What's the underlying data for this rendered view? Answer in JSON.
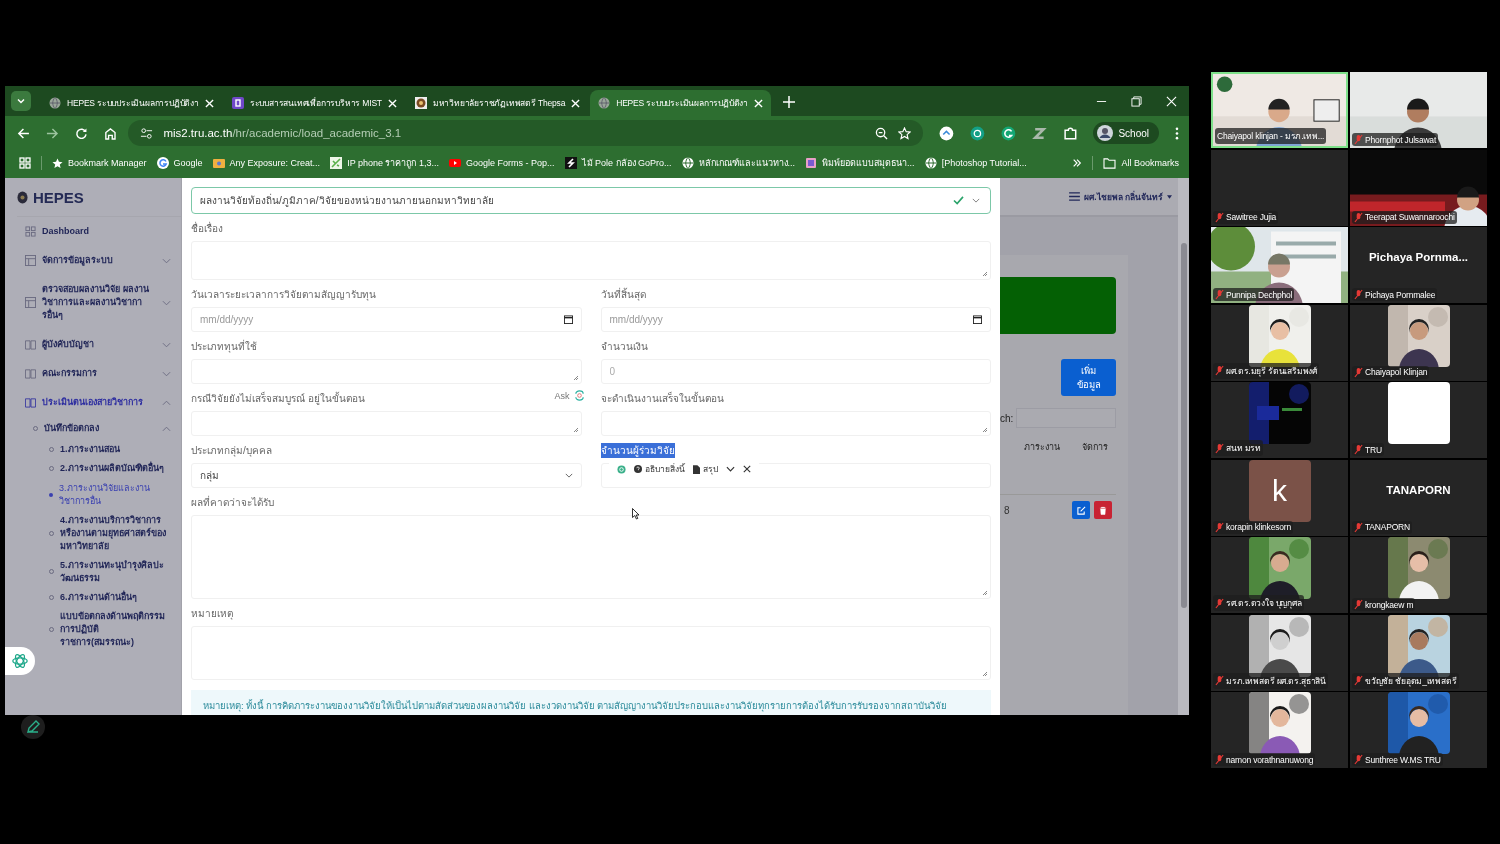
{
  "browser": {
    "tabs": [
      {
        "title": "HEPES ระบบประเมินผลการปฏิบัติงา",
        "selected": false
      },
      {
        "title": "ระบบสารสนเทศเพื่อการบริหาร MIST",
        "selected": false
      },
      {
        "title": "มหาวิทยาลัยราชภัฏเทพสตรี Thepsa",
        "selected": false
      },
      {
        "title": "HEPES ระบบประเมินผลการปฏิบัติงา",
        "selected": true
      }
    ],
    "url_host": "mis2.tru.ac.th",
    "url_path": "/hr/academic/load_academic_3.1",
    "profile": "School",
    "bookmarks": [
      "Bookmark Manager",
      "Google",
      "Any Exposure: Creat...",
      "IP phone ราคาถูก 1,3...",
      "Google Forms - Pop...",
      "ไม้ Pole กล้อง GoPro...",
      "หลักเกณฑ์และแนวทาง...",
      "พิมพ์ยอดแบบสมุดธนา...",
      "[Photoshop Tutorial..."
    ],
    "all_bookmarks": "All Bookmarks"
  },
  "app": {
    "brand": "HEPES",
    "user": "ผศ.ไชยพล กลิ่นจันทร์",
    "sidebar": [
      {
        "label": "Dashboard",
        "selected": false
      },
      {
        "label": "จัดการข้อมูลระบบ",
        "expanded": false,
        "selected": false
      },
      {
        "label": "ตรวจสอบผลงานวิจัย ผลงานวิชาการและผลงานวิชาการอื่นๆ",
        "expanded": false,
        "selected": false
      },
      {
        "label": "ผู้บังคับบัญชา",
        "expanded": false,
        "selected": false
      },
      {
        "label": "คณะกรรมการ",
        "expanded": false,
        "selected": false
      },
      {
        "label": "ประเมินตนเองสายวิชาการ",
        "expanded": true,
        "selected": true,
        "children": [
          {
            "label": "บันทึกข้อตกลง",
            "expanded": true,
            "children": [
              {
                "label": "1.ภาระงานสอน",
                "selected": false
              },
              {
                "label": "2.ภาระงานผลิตบัณฑิตอื่นๆ",
                "selected": false
              },
              {
                "label": "3.ภาระงานวิจัยและงานวิชาการอื่น",
                "selected": true
              },
              {
                "label": "4.ภาระงานบริการวิชาการหรืองานตามยุทธศาสตร์ของมหาวิทยาลัย",
                "selected": false
              },
              {
                "label": "5.ภาระงานทะนุบำรุงศิลปะวัฒนธรรม",
                "selected": false
              },
              {
                "label": "6.ภาระงานด้านอื่นๆ",
                "selected": false
              },
              {
                "label": "แบบข้อตกลงด้านพฤติกรรมการปฏิบัติราชการ(สมรรถนะ)",
                "selected": false
              }
            ]
          }
        ]
      }
    ],
    "form": {
      "type_select": {
        "value": "ผลงานวิจัยท้องถิ่น/ภูมิภาค/วิจัยของหน่วยงานภายนอกมหาวิทยาลัย",
        "valid": true
      },
      "rows": [
        [
          {
            "kind": "textarea",
            "label": "ชื่อเรื่อง"
          }
        ],
        [
          {
            "kind": "date",
            "label": "วันเวลาระยะเวลาการวิจัยตามสัญญารับทุน",
            "placeholder": "mm/dd/yyyy"
          },
          {
            "kind": "date",
            "label": "วันที่สิ้นสุด",
            "placeholder": "mm/dd/yyyy"
          }
        ],
        [
          {
            "kind": "textarea",
            "label": "ประเภททุนที่ใช้"
          },
          {
            "kind": "number",
            "label": "จำนวนเงิน",
            "placeholder": "0"
          }
        ],
        [
          {
            "kind": "textarea",
            "label": "กรณีวิจัยยังไม่เสร็จสมบูรณ์ อยู่ในขั้นตอน",
            "ask": "Ask"
          },
          {
            "kind": "textarea",
            "label": "จะดำเนินงานเสร็จในขั้นตอน"
          }
        ],
        [
          {
            "kind": "select",
            "label": "ประเภทกลุ่ม/บุคคล",
            "value": "กลุ่ม"
          },
          {
            "kind": "select",
            "label": "จำนวนผู้ร่วมวิจัย",
            "highlighted": true
          }
        ],
        [
          {
            "kind": "textarea",
            "label": "ผลที่คาดว่าจะได้รับ"
          }
        ],
        [
          {
            "kind": "textarea",
            "label": "หมายเหตุ"
          }
        ]
      ],
      "popup": {
        "explain": "อธิบายสิ่งนี้",
        "summarize": "สรุป"
      },
      "note": "หมายเหตุ: ทั้งนี้ การคิดภาระงานของงานวิจัยให้เป็นไปตามสัดส่วนของผลงานวิจัย และงวดงานวิจัย ตามสัญญางานวิจัยประกอบและงานวิจัยทุกรายการต้องได้รับการรับรองจากสถาบันวิจัย"
    },
    "background": {
      "add_button": "เพิ่มข้อมูล",
      "search_label": "ch:",
      "columns": [
        "ภาระงาน",
        "จัดการ"
      ],
      "row_value": "8"
    }
  },
  "meeting": {
    "tiles": [
      {
        "name": "Chaiyapol klinjan - มรภ.เทพ...",
        "kind": "video",
        "muted": false,
        "speaking": true
      },
      {
        "name": "Phornphot Julsawat",
        "kind": "video",
        "muted": true,
        "speaking": false
      },
      {
        "name": "Sawitree Jujia",
        "kind": "dark",
        "muted": true,
        "speaking": false
      },
      {
        "name": "Teerapat Suwannaroochi",
        "kind": "video",
        "muted": true,
        "speaking": false
      },
      {
        "name": "Punnipa Dechphol",
        "kind": "video",
        "muted": true,
        "speaking": false
      },
      {
        "name": "Pichaya Pornmalee",
        "kind": "name",
        "display": "Pichaya  Pornma...",
        "muted": true,
        "speaking": false
      },
      {
        "name": "ผศ.ดร.มยุรี รัตนเสริมพงศ์",
        "kind": "avatar",
        "muted": true,
        "speaking": false
      },
      {
        "name": "Chaiyapol Klinjan",
        "kind": "avatar",
        "muted": true,
        "speaking": false
      },
      {
        "name": "สนท มรท",
        "kind": "avatar",
        "muted": true,
        "speaking": false
      },
      {
        "name": "TRU",
        "kind": "blank",
        "muted": true,
        "speaking": false
      },
      {
        "name": "korapin klinkesorn",
        "kind": "letter",
        "display": "k",
        "muted": true,
        "speaking": false
      },
      {
        "name": "TANAPORN",
        "kind": "name",
        "display": "TANAPORN",
        "muted": true,
        "speaking": false
      },
      {
        "name": "รศ.ดร.ดวงใจ บุญกุศล",
        "kind": "avatar",
        "muted": true,
        "speaking": false
      },
      {
        "name": "krongkaew m",
        "kind": "avatar",
        "muted": true,
        "speaking": false
      },
      {
        "name": "มรภ.เทพสตรี ผศ.ดร.สุธาสินี",
        "kind": "avatar",
        "muted": true,
        "speaking": false
      },
      {
        "name": "ขวัญชัย  ชัยอุดม_เทพสตรี",
        "kind": "avatar",
        "muted": true,
        "speaking": false
      },
      {
        "name": "namon vorathnanuwong",
        "kind": "avatar",
        "muted": true,
        "speaking": false
      },
      {
        "name": "Sunthree W.MS TRU",
        "kind": "avatar",
        "muted": true,
        "speaking": false
      }
    ]
  }
}
